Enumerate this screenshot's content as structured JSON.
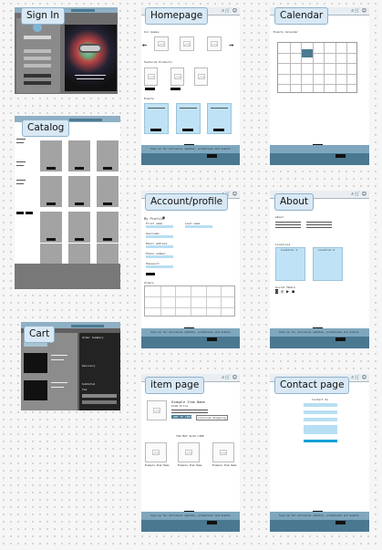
{
  "labels": {
    "signin": "Sign In",
    "catalog": "Catalog",
    "cart": "Cart",
    "homepage": "Homepage",
    "calendar": "Calendar",
    "account": "Account/profile",
    "about": "About",
    "item": "item page",
    "contact": "Contact page"
  },
  "homepage": {
    "section_our_games": "Our Games",
    "section_featured": "Featured Products",
    "section_events": "Events",
    "footer_text": "Sign up for exclusive updates, promotions and events"
  },
  "calendar": {
    "heading": "Events Calendar"
  },
  "account": {
    "heading": "My Profile",
    "first_name": "First name",
    "last_name": "Last name",
    "username": "Username",
    "email": "Email address",
    "phone": "Phone number",
    "password": "Password",
    "orders_heading": "Orders"
  },
  "about": {
    "about_heading": "About",
    "locations_heading": "Locations",
    "location1": "Location 1",
    "location2": "Location 2",
    "social_heading": "Social Media"
  },
  "item": {
    "name": "Example Item Name",
    "price": "Item Price",
    "add_button": "ADD TO CART",
    "continue_button": "Continue Shopping",
    "also_like": "YOU MAY ALSO LIKE",
    "rec1": "Example Item Name",
    "rec2": "Example Item Name",
    "rec3": "Example Item Name"
  },
  "contact": {
    "heading": "Contact Us"
  },
  "cart": {
    "summary": "Order Summary",
    "delivery": "Delivery",
    "subtotal": "Subtotal",
    "tax": "Tax"
  }
}
